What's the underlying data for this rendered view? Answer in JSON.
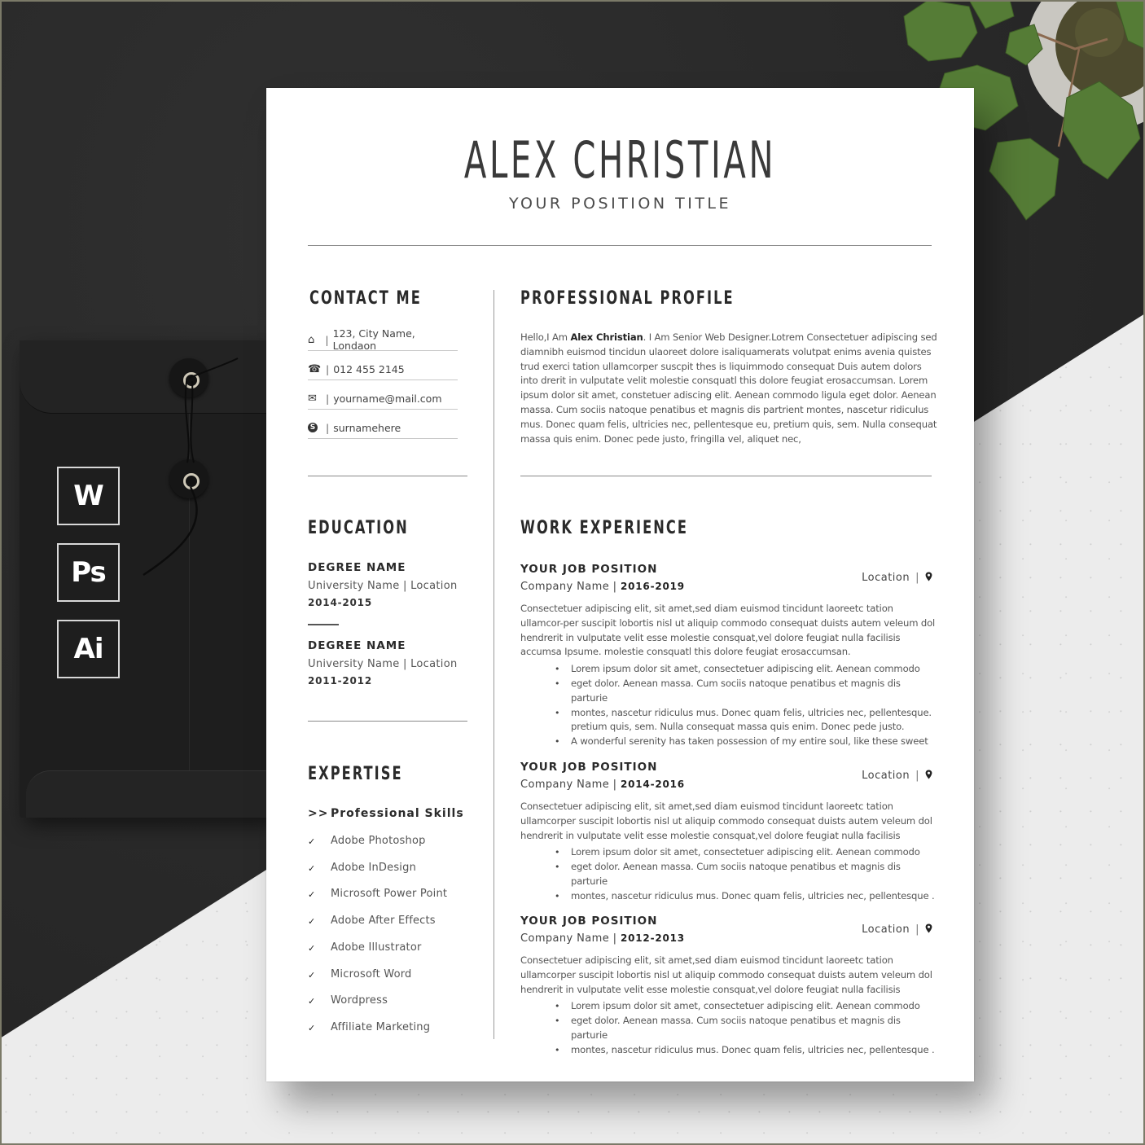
{
  "resume": {
    "name": "ALEX CHRISTIAN",
    "position_title": "YOUR POSITION TITLE",
    "contact": {
      "title": "CONTACT ME",
      "items": [
        {
          "icon": "home-icon",
          "glyph": "⌂",
          "separator": "|",
          "text": "123, City Name, Londaon"
        },
        {
          "icon": "phone-icon",
          "glyph": "☎",
          "separator": "|",
          "text": "012 455 2145"
        },
        {
          "icon": "mail-icon",
          "glyph": "✉",
          "separator": "|",
          "text": "yourname@mail.com"
        },
        {
          "icon": "skype-icon",
          "glyph": "S",
          "separator": "|",
          "text": "surnamehere"
        }
      ]
    },
    "profile": {
      "title": "PROFESSIONAL PROFILE",
      "intro": "Hello,I Am ",
      "name_bold": "Alex Christian",
      "text": ". I Am Senior Web Designer.Lotrem Consectetuer adipiscing sed diamnibh euismod tincidun ulaoreet dolore isaliquamerats volutpat enims avenia quistes trud exerci tation ullamcorper suscpit thes is liquimmodo consequat Duis autem  dolors into drerit in vulputate velit  molestie consquatl this dolore feugiat erosaccumsan. Lorem ipsum dolor sit amet, constetuer adiscing elit. Aenean commodo ligula eget dolor. Aenean massa. Cum sociis natoque penatibus et magnis dis partrient montes, nascetur ridiculus mus. Donec quam felis, ultricies nec, pellentesque eu, pretium quis, sem. Nulla consequat massa quis enim. Donec pede justo, fringilla vel, aliquet nec,"
    },
    "education": {
      "title": "EDUCATION",
      "items": [
        {
          "degree": "DEGREE NAME",
          "university": "University Name | Location",
          "years": "2014-2015"
        },
        {
          "degree": "DEGREE NAME",
          "university": "University Name | Location",
          "years": "2011-2012"
        }
      ]
    },
    "expertise": {
      "title": "EXPERTISE",
      "heading_marker": ">>",
      "heading": "Professional Skills",
      "check_glyph": "✓",
      "skills": [
        "Adobe Photoshop",
        "Adobe InDesign",
        "Microsoft Power Point",
        "Adobe After Effects",
        "Adobe Illustrator",
        "Microsoft Word",
        "Wordpress",
        "Affiliate Marketing"
      ]
    },
    "work": {
      "title": "WORK EXPERIENCE",
      "jobs": [
        {
          "position": "YOUR JOB POSITION",
          "company": "Company Name | ",
          "years": "2016-2019",
          "location": "Location",
          "separator": "|",
          "pin_glyph": "⚲",
          "description": "Consectetuer adipiscing elit, sit amet,sed diam euismod tincidunt laoreetc tation ullamcor-per suscipit lobortis nisl ut aliquip commodo consequat duists autem veleum dol hendrerit in vulputate velit esse molestie consquat,vel dolore feugiat nulla facilisis accumsa Ipsume. molestie consquatl this dolore feugiat erosaccumsan.",
          "bullets": [
            "Lorem ipsum dolor sit amet, consectetuer adipiscing elit. Aenean commodo",
            "eget dolor. Aenean massa. Cum sociis natoque penatibus et magnis dis parturie",
            "montes, nascetur ridiculus mus. Donec quam felis, ultricies nec, pellentesque. pretium quis, sem. Nulla consequat massa quis enim. Donec pede justo.",
            "A wonderful serenity has taken possession of my entire soul, like these sweet"
          ]
        },
        {
          "position": "YOUR JOB POSITION",
          "company": "Company Name | ",
          "years": "2014-2016",
          "location": "Location",
          "separator": "|",
          "pin_glyph": "⚲",
          "description": "Consectetuer adipiscing elit, sit amet,sed diam euismod tincidunt laoreetc tation ullamcorper suscipit lobortis nisl ut aliquip commodo consequat duists autem veleum dol hendrerit in vulputate velit esse molestie consquat,vel dolore feugiat nulla facilisis",
          "bullets": [
            "Lorem ipsum dolor sit amet, consectetuer adipiscing elit. Aenean commodo",
            "eget dolor. Aenean massa. Cum sociis natoque penatibus et magnis dis parturie",
            "montes, nascetur ridiculus mus. Donec quam felis, ultricies nec, pellentesque ."
          ]
        },
        {
          "position": "YOUR JOB POSITION",
          "company": "Company Name | ",
          "years": "2012-2013",
          "location": "Location",
          "separator": "|",
          "pin_glyph": "⚲",
          "description": "Consectetuer adipiscing elit, sit amet,sed diam euismod tincidunt laoreetc tation ullamcorper suscipit lobortis nisl ut aliquip commodo consequat duists autem veleum dol hendrerit in vulputate velit esse molestie consquat,vel dolore feugiat nulla facilisis",
          "bullets": [
            "Lorem ipsum dolor sit amet, consectetuer adipiscing elit. Aenean commodo",
            "eget dolor. Aenean massa. Cum sociis natoque penatibus et magnis dis parturie",
            "montes, nascetur ridiculus mus. Donec quam felis, ultricies nec, pellentesque ."
          ]
        }
      ]
    }
  },
  "app_badges": [
    "W",
    "Ps",
    "Ai"
  ],
  "colors": {
    "background_dark": "#2a2a2a",
    "background_light": "#ececec",
    "paper": "#ffffff",
    "text_dark": "#2a2a2a",
    "text_body": "#555555",
    "leaf_green": "#4f7a34"
  }
}
